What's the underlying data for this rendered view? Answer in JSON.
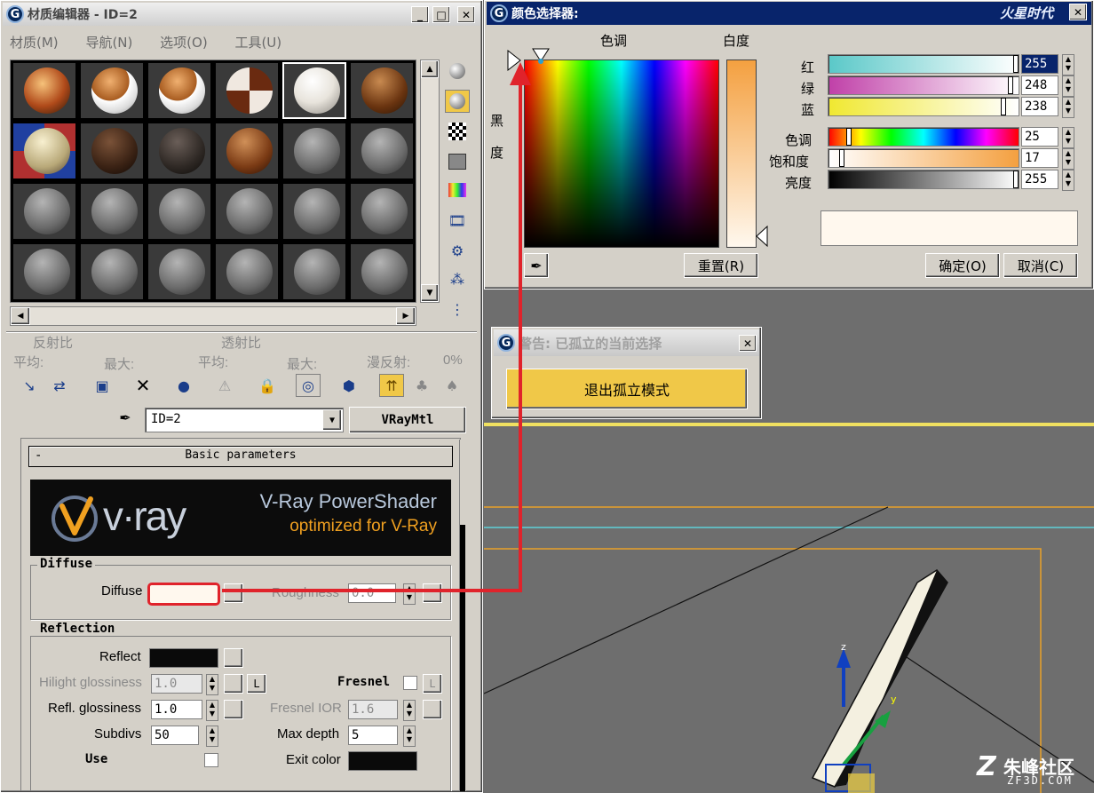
{
  "material_editor": {
    "title": "材质编辑器 - ID=2",
    "menu": [
      "材质(M)",
      "导航(N)",
      "选项(O)",
      "工具(U)"
    ],
    "stats": {
      "reflect_label": "反射比",
      "transmit_label": "透射比",
      "avg_label": "平均:",
      "max_label": "最大:",
      "avg2_label": "平均:",
      "max2_label": "最大:",
      "diffuse_label": "漫反射:",
      "diffuse_value": "0%"
    },
    "material_name": "ID=2",
    "material_type": "VRayMtl",
    "rollout_title": "Basic parameters",
    "vray_brand": "v·ray",
    "vray_line1": "V-Ray PowerShader",
    "vray_line2": "optimized for V-Ray",
    "diffuse": {
      "group": "Diffuse",
      "label": "Diffuse",
      "roughness_label": "Roughness",
      "roughness_value": "0.0",
      "color": "#fff8ee"
    },
    "reflection": {
      "group": "Reflection",
      "reflect_label": "Reflect",
      "hilight_label": "Hilight glossiness",
      "hilight_value": "1.0",
      "l_button": "L",
      "fresnel_label": "Fresnel",
      "l2_button": "L",
      "refl_gloss_label": "Refl. glossiness",
      "refl_gloss_value": "1.0",
      "fresnel_ior_label": "Fresnel IOR",
      "fresnel_ior_value": "1.6",
      "subdivs_label": "Subdivs",
      "subdivs_value": "50",
      "max_depth_label": "Max depth",
      "max_depth_value": "5",
      "use_label": "Use",
      "exit_color_label": "Exit color"
    }
  },
  "color_picker": {
    "title": "颜色选择器:",
    "hue_label": "色调",
    "whiteness_label": "白度",
    "black_label_1": "黑",
    "black_label_2": "度",
    "reset_button": "重置(R)",
    "ok_button": "确定(O)",
    "cancel_button": "取消(C)",
    "channels": [
      {
        "label": "红",
        "value": "255"
      },
      {
        "label": "绿",
        "value": "248"
      },
      {
        "label": "蓝",
        "value": "238"
      },
      {
        "label": "色调",
        "value": "25"
      },
      {
        "label": "饱和度",
        "value": "17"
      },
      {
        "label": "亮度",
        "value": "255"
      }
    ],
    "preview_color": "#fff8ee"
  },
  "warning": {
    "title": "警告: 已孤立的当前选择",
    "exit_button": "退出孤立模式"
  },
  "watermark": {
    "site": "朱峰社区",
    "url": "ZF3D.COM",
    "top_logo": "火星时代"
  },
  "colors": {
    "accent_red": "#e0232b",
    "gizmo_blue": "#1040c0",
    "highlight_yellow": "#f0c848"
  }
}
